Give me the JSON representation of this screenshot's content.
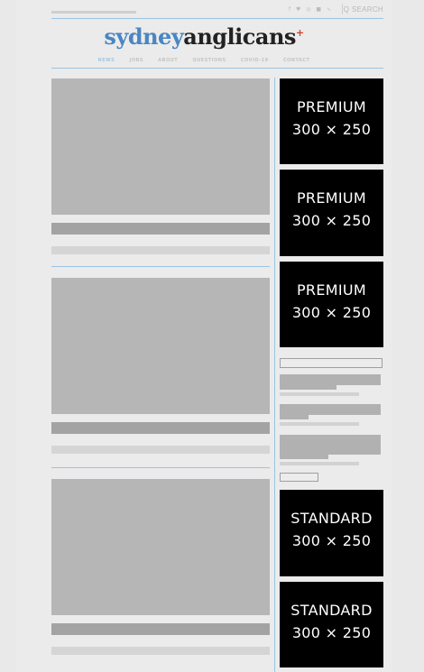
{
  "header": {
    "social_icons": [
      "facebook-icon",
      "twitter-icon",
      "instagram-icon",
      "youtube-icon",
      "rss-icon"
    ],
    "social_glyphs": "f ♥ ◎ ■ ∿",
    "search_icon": "Q",
    "search_label": "SEARCH"
  },
  "logo": {
    "part1": "sydney",
    "part2": "anglicans",
    "mark": "+"
  },
  "nav": {
    "items": [
      "NEWS",
      "JOBS",
      "ABOUT",
      "QUESTIONS",
      "COVID-19",
      "CONTACT"
    ]
  },
  "ads": [
    {
      "line1": "PREMIUM",
      "line2": "300 × 250"
    },
    {
      "line1": "PREMIUM",
      "line2": "300 × 250"
    },
    {
      "line1": "PREMIUM",
      "line2": "300 × 250"
    },
    {
      "line1": "STANDARD",
      "line2": "300 × 250"
    },
    {
      "line1": "STANDARD",
      "line2": "300 × 250"
    }
  ],
  "colors": {
    "accent_blue": "#4a86c2",
    "logo_dark": "#222222",
    "logo_cross": "#d53b2c",
    "divider_blue": "#9cc3e2",
    "ad_black": "#000000"
  }
}
